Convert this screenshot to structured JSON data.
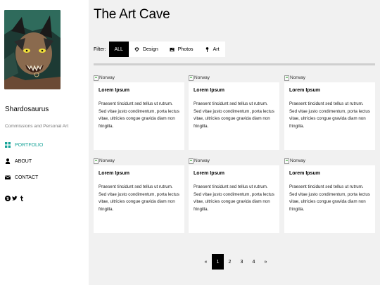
{
  "sidebar": {
    "brand": "Shardosaurus",
    "tagline": "Commissions and Personal Art",
    "nav": [
      {
        "label": "PORTFOLIO",
        "icon": "grid-icon",
        "active": true
      },
      {
        "label": "ABOUT",
        "icon": "user-icon",
        "active": false
      },
      {
        "label": "CONTACT",
        "icon": "envelope-icon",
        "active": false
      }
    ],
    "socials": [
      "deviantart-icon",
      "twitter-icon",
      "tumblr-icon"
    ]
  },
  "main": {
    "title": "The Art Cave",
    "filter": {
      "label": "Filter:",
      "buttons": [
        {
          "label": "ALL",
          "icon": "",
          "active": true
        },
        {
          "label": "Design",
          "icon": "diamond-icon",
          "active": false
        },
        {
          "label": "Photos",
          "icon": "photo-icon",
          "active": false
        },
        {
          "label": "Art",
          "icon": "map-pin-icon",
          "active": false
        }
      ]
    },
    "cards": [
      {
        "img_alt": "Norway",
        "title": "Lorem Ipsum",
        "text": "Praesent tincidunt sed tellus ut rutrum. Sed vitae justo condimentum, porta lectus vitae, ultricies congue gravida diam non fringilla."
      },
      {
        "img_alt": "Norway",
        "title": "Lorem Ipsum",
        "text": "Praesent tincidunt sed tellus ut rutrum. Sed vitae justo condimentum, porta lectus vitae, ultricies congue gravida diam non fringilla."
      },
      {
        "img_alt": "Norway",
        "title": "Lorem Ipsum",
        "text": "Praesent tincidunt sed tellus ut rutrum. Sed vitae justo condimentum, porta lectus vitae, ultricies congue gravida diam non fringilla."
      },
      {
        "img_alt": "Norway",
        "title": "Lorem Ipsum",
        "text": "Praesent tincidunt sed tellus ut rutrum. Sed vitae justo condimentum, porta lectus vitae, ultricies congue gravida diam non fringilla."
      },
      {
        "img_alt": "Norway",
        "title": "Lorem Ipsum",
        "text": "Praesent tincidunt sed tellus ut rutrum. Sed vitae justo condimentum, porta lectus vitae, ultricies congue gravida diam non fringilla."
      },
      {
        "img_alt": "Norway",
        "title": "Lorem Ipsum",
        "text": "Praesent tincidunt sed tellus ut rutrum. Sed vitae justo condimentum, porta lectus vitae, ultricies congue gravida diam non fringilla."
      }
    ],
    "pagination": {
      "prev": "«",
      "pages": [
        "1",
        "2",
        "3",
        "4"
      ],
      "current": "1",
      "next": "»"
    }
  },
  "colors": {
    "accent": "#17a398",
    "sidebar_bg": "#ffffff",
    "page_bg": "#f1f1f1",
    "active_filter_bg": "#000000"
  }
}
